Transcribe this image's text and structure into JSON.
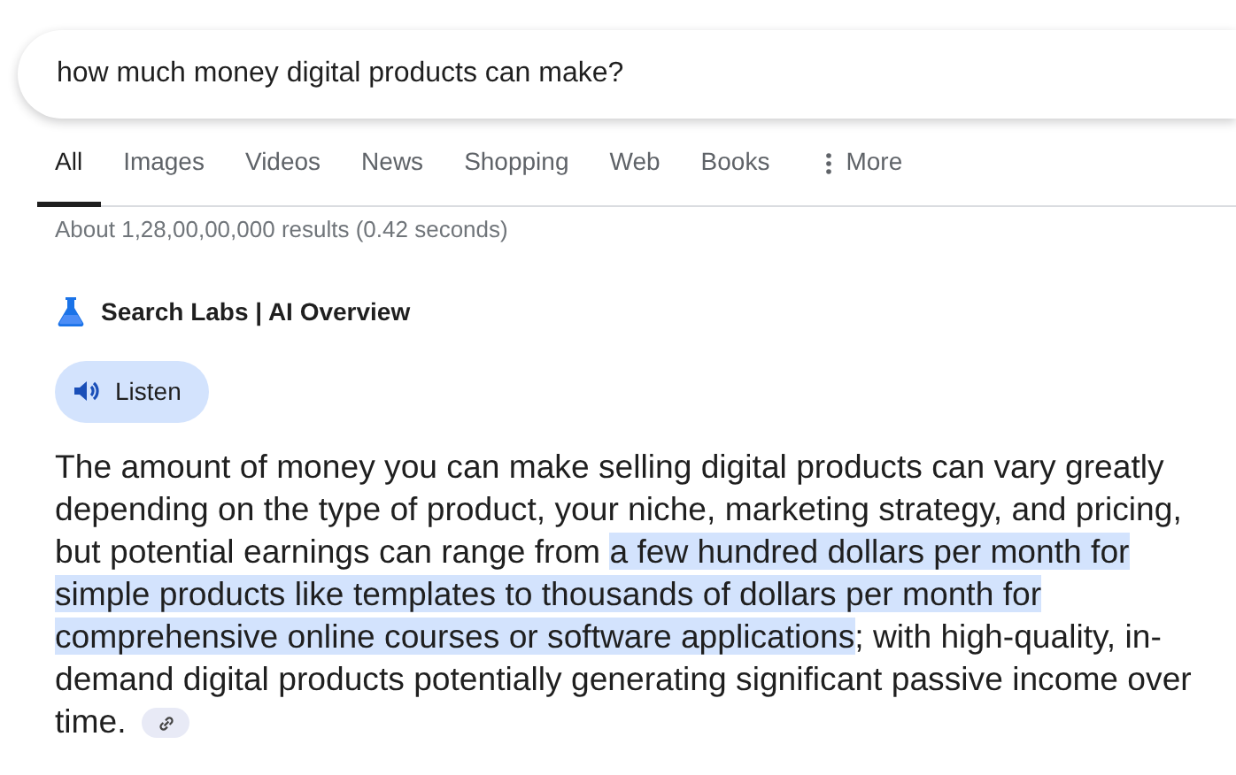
{
  "search": {
    "value": "how much money digital products can make?"
  },
  "tabs": [
    {
      "label": "All",
      "selected": true,
      "kind": "tab"
    },
    {
      "label": "Images",
      "selected": false,
      "kind": "tab"
    },
    {
      "label": "Videos",
      "selected": false,
      "kind": "tab"
    },
    {
      "label": "News",
      "selected": false,
      "kind": "tab"
    },
    {
      "label": "Shopping",
      "selected": false,
      "kind": "tab"
    },
    {
      "label": "Web",
      "selected": false,
      "kind": "tab"
    },
    {
      "label": "Books",
      "selected": false,
      "kind": "tab"
    },
    {
      "label": "More",
      "selected": false,
      "kind": "more"
    }
  ],
  "result_stats": "About 1,28,00,00,000 results (0.42 seconds)",
  "overview": {
    "title": "Search Labs | AI Overview",
    "listen_button": "Listen",
    "text_before": "The amount of money you can make selling digital products can vary greatly depending on the type of product, your niche, marketing strategy, and pricing, but potential earnings can range from ",
    "text_highlighted": "a few hundred dollars per month for simple products like templates to thousands of dollars per month for comprehensive online courses or software applications",
    "text_after": "; with high-quality, in-demand digital products potentially generating significant passive income over time."
  }
}
